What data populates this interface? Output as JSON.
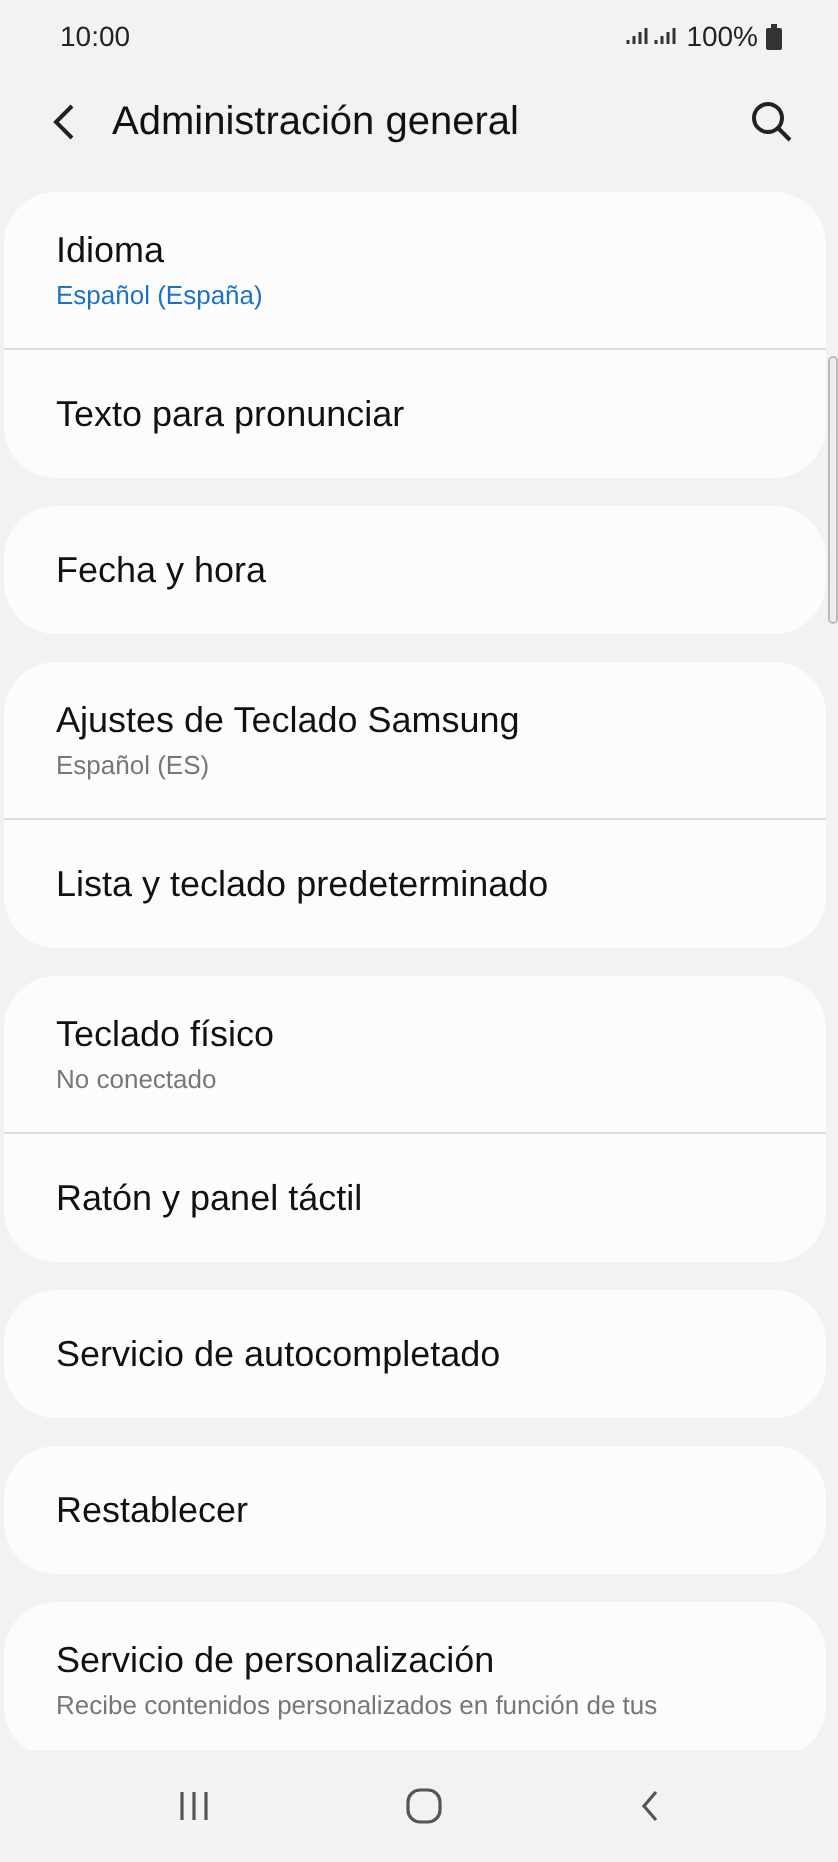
{
  "status_bar": {
    "time": "10:00",
    "battery": "100%"
  },
  "header": {
    "title": "Administración general"
  },
  "groups": [
    {
      "items": [
        {
          "title": "Idioma",
          "subtitle": {
            "text": "Español (España)",
            "kind": "accent"
          }
        },
        {
          "title": "Texto para pronunciar"
        }
      ]
    },
    {
      "items": [
        {
          "title": "Fecha y hora"
        }
      ]
    },
    {
      "items": [
        {
          "title": "Ajustes de Teclado Samsung",
          "subtitle": {
            "text": "Español (ES)",
            "kind": "muted"
          }
        },
        {
          "title": "Lista y teclado predeterminado"
        }
      ]
    },
    {
      "items": [
        {
          "title": "Teclado físico",
          "subtitle": {
            "text": "No conectado",
            "kind": "muted"
          }
        },
        {
          "title": "Ratón y panel táctil"
        }
      ]
    },
    {
      "items": [
        {
          "title": "Servicio de autocompletado"
        }
      ]
    },
    {
      "items": [
        {
          "title": "Restablecer"
        }
      ]
    },
    {
      "items": [
        {
          "title": "Servicio de personalización",
          "subtitle": {
            "text": "Recibe contenidos personalizados en función de tus",
            "kind": "muted"
          }
        }
      ]
    }
  ]
}
